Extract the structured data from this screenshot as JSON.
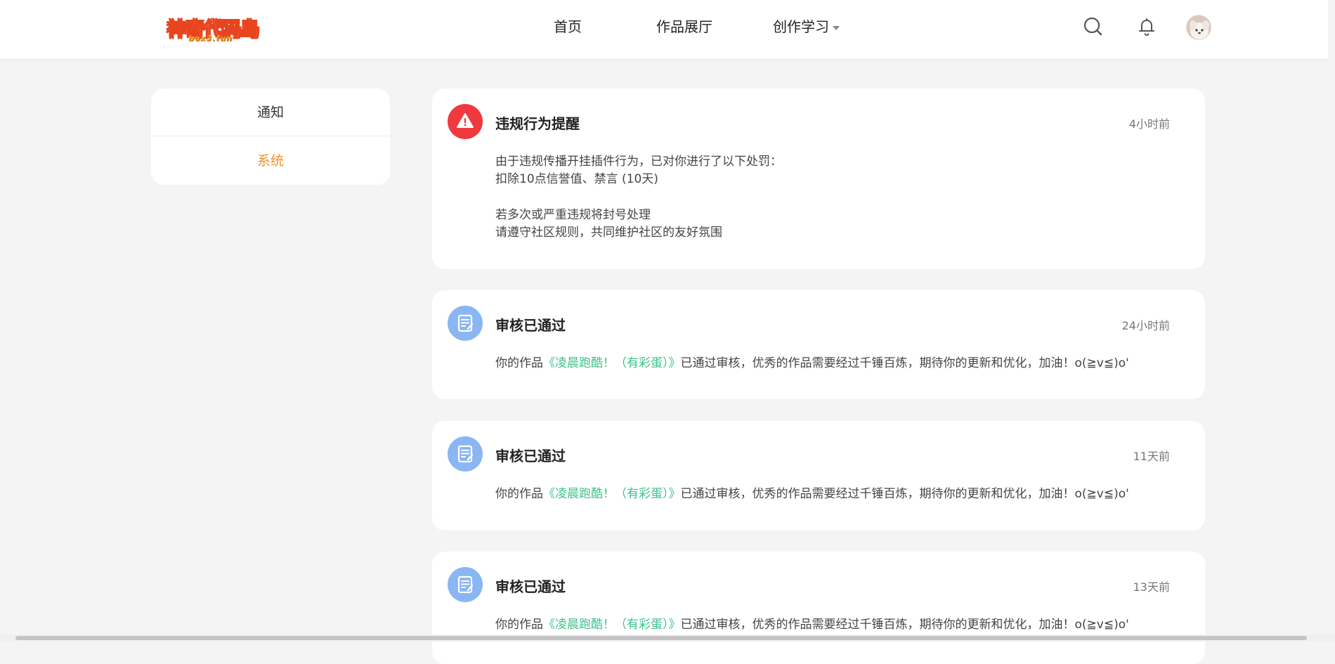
{
  "header": {
    "logo_text": "神奇代码岛",
    "logo_sub": "box3.fun",
    "nav": {
      "home": "首页",
      "gallery": "作品展厅",
      "learn": "创作学习"
    }
  },
  "sidebar": {
    "items": [
      {
        "label": "通知"
      },
      {
        "label": "系统"
      }
    ]
  },
  "notifications": [
    {
      "icon": "warning-icon",
      "title": "违规行为提醒",
      "time": "4小时前",
      "lines": [
        "由于违规传播开挂插件行为，已对你进行了以下处罚：",
        "扣除10点信誉值、禁言 (10天)",
        "若多次或严重违规将封号处理",
        "请遵守社区规则，共同维护社区的友好氛围"
      ]
    },
    {
      "icon": "document-icon",
      "title": "审核已通过",
      "time": "24小时前",
      "prefix": "你的作品",
      "work": "《凌晨跑酷！（有彩蛋）》",
      "suffix": "已通过审核，优秀的作品需要经过千锤百炼，期待你的更新和优化，加油！o(≧v≦)o'"
    },
    {
      "icon": "document-icon",
      "title": "审核已通过",
      "time": "11天前",
      "prefix": "你的作品",
      "work": "《凌晨跑酷！（有彩蛋）》",
      "suffix": "已通过审核，优秀的作品需要经过千锤百炼，期待你的更新和优化，加油！o(≧v≦)o'"
    },
    {
      "icon": "document-icon",
      "title": "审核已通过",
      "time": "13天前",
      "prefix": "你的作品",
      "work": "《凌晨跑酷！（有彩蛋）》",
      "suffix": "已通过审核，优秀的作品需要经过千锤百炼，期待你的更新和优化，加油！o(≧v≦)o'"
    }
  ],
  "colors": {
    "accent_orange": "#f0922b",
    "link_green": "#3cc28a",
    "warning_red": "#f0393f",
    "doc_blue": "#8ab6f3"
  }
}
